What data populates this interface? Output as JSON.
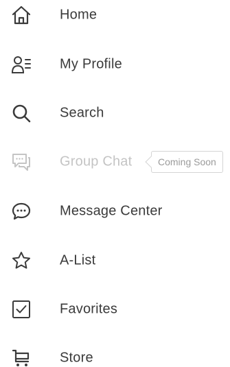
{
  "menu": {
    "items": [
      {
        "label": "Home",
        "icon": "home-icon"
      },
      {
        "label": "My Profile",
        "icon": "profile-icon"
      },
      {
        "label": "Search",
        "icon": "search-icon"
      },
      {
        "label": "Group Chat",
        "icon": "group-chat-icon",
        "disabled": true,
        "badge": "Coming Soon"
      },
      {
        "label": "Message Center",
        "icon": "message-icon"
      },
      {
        "label": "A-List",
        "icon": "star-icon"
      },
      {
        "label": "Favorites",
        "icon": "checkbox-icon"
      },
      {
        "label": "Store",
        "icon": "cart-icon"
      }
    ]
  },
  "colors": {
    "text": "#3a3a3a",
    "icon": "#3a3a3a",
    "disabled": "#c4c4c4",
    "tooltip_border": "#d4d4d4",
    "tooltip_text": "#9a9a9a"
  }
}
